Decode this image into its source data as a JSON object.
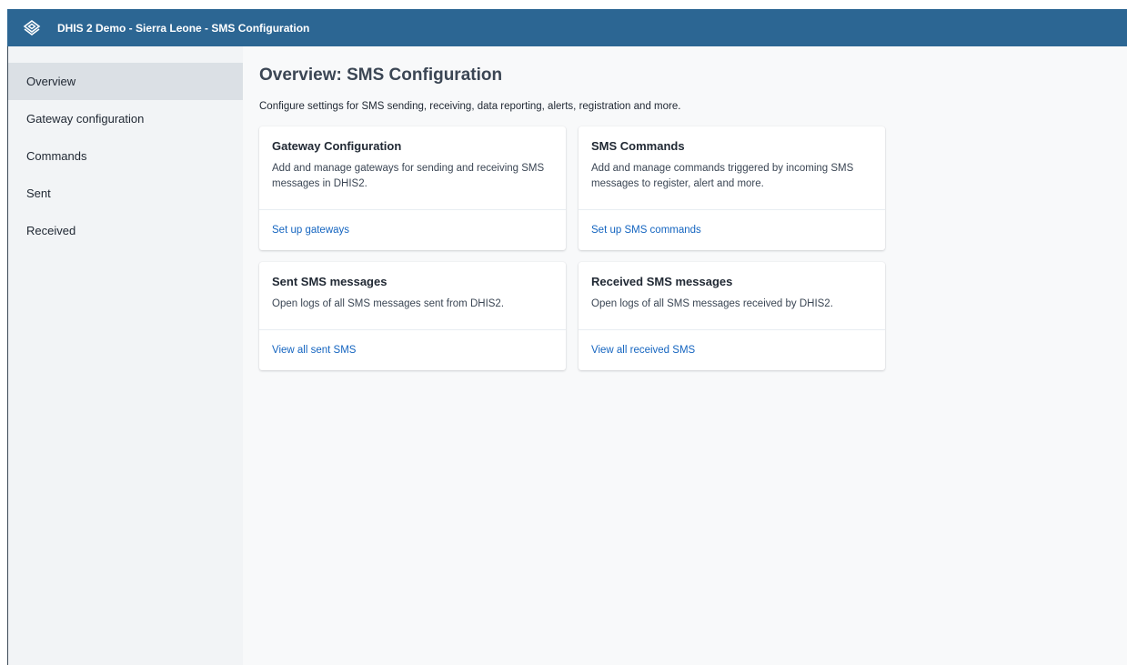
{
  "header": {
    "title": "DHIS 2 Demo - Sierra Leone - SMS Configuration",
    "logo_icon": "dhis2-logo-icon",
    "bar_color": "#2c6693"
  },
  "sidebar": {
    "items": [
      {
        "label": "Overview",
        "active": true
      },
      {
        "label": "Gateway configuration",
        "active": false
      },
      {
        "label": "Commands",
        "active": false
      },
      {
        "label": "Sent",
        "active": false
      },
      {
        "label": "Received",
        "active": false
      }
    ]
  },
  "main": {
    "title": "Overview: SMS Configuration",
    "description": "Configure settings for SMS sending, receiving, data reporting, alerts, registration and more.",
    "cards": [
      {
        "title": "Gateway Configuration",
        "text": "Add and manage gateways for sending and receiving SMS messages in DHIS2.",
        "link": "Set up gateways"
      },
      {
        "title": "SMS Commands",
        "text": "Add and manage commands triggered by incoming SMS messages to register, alert and more.",
        "link": "Set up SMS commands"
      },
      {
        "title": "Sent SMS messages",
        "text": "Open logs of all SMS messages sent from DHIS2.",
        "link": "View all sent SMS"
      },
      {
        "title": "Received SMS messages",
        "text": "Open logs of all SMS messages received by DHIS2.",
        "link": "View all received SMS"
      }
    ]
  },
  "colors": {
    "link": "#1565c0",
    "active_nav": "#dbe0e5"
  }
}
